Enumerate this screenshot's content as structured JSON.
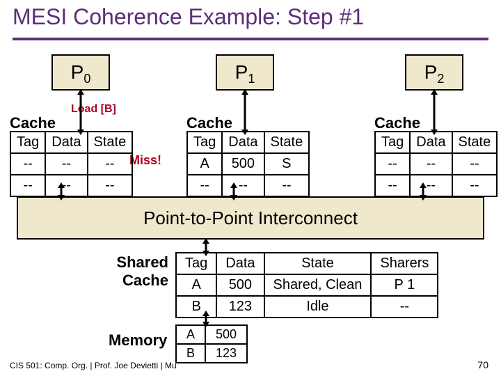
{
  "title": "MESI Coherence Example: Step #1",
  "processors": [
    "P",
    "P",
    "P"
  ],
  "processors_sub": [
    "0",
    "1",
    "2"
  ],
  "load_label": "Load [B]",
  "miss_label": "Miss!",
  "cache_label": "Cache",
  "cache_headers": [
    "Tag",
    "Data",
    "State"
  ],
  "cache0_rows": [
    [
      "--",
      "--",
      "--"
    ],
    [
      "--",
      "--",
      "--"
    ]
  ],
  "cache1_rows": [
    [
      "A",
      "500",
      "S"
    ],
    [
      "--",
      "--",
      "--"
    ]
  ],
  "cache2_rows": [
    [
      "--",
      "--",
      "--"
    ],
    [
      "--",
      "--",
      "--"
    ]
  ],
  "interconnect": "Point-to-Point Interconnect",
  "sc_label_l1": "Shared",
  "sc_label_l2": "Cache",
  "sc_headers": [
    "Tag",
    "Data",
    "State",
    "Sharers"
  ],
  "sc_rows": [
    [
      "A",
      "500",
      "Shared, Clean",
      "P 1"
    ],
    [
      "B",
      "123",
      "Idle",
      "--"
    ]
  ],
  "mem_label": "Memory",
  "mem_rows": [
    [
      "A",
      "500"
    ],
    [
      "B",
      "123"
    ]
  ],
  "footer": "CIS 501: Comp. Org.  |  Prof. Joe Devietti  |  Mu",
  "pagenum": "70"
}
